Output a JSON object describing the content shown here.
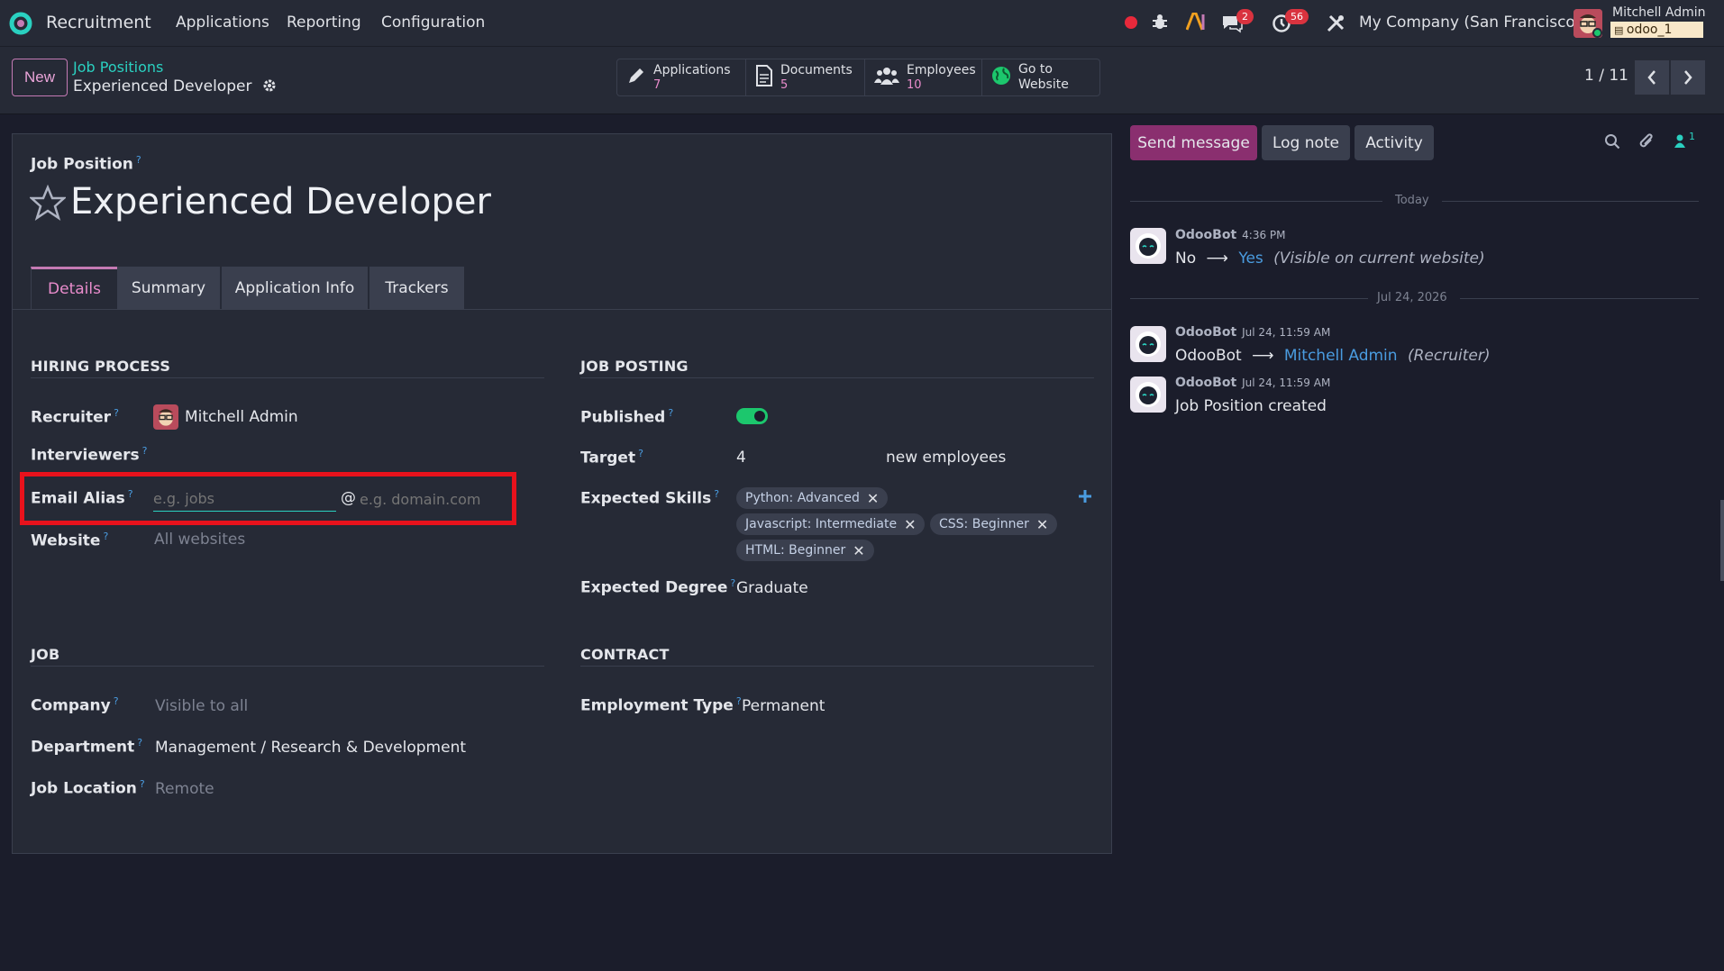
{
  "navbar": {
    "app_name": "Recruitment",
    "menus": [
      "Applications",
      "Reporting",
      "Configuration"
    ],
    "chat_badge": "2",
    "activity_badge": "56",
    "company": "My Company (San Francisco)",
    "user_name": "Mitchell Admin",
    "db_name": "odoo_1",
    "colors": {
      "accent": "#2ad0c0",
      "badge": "#d9333f",
      "record_dot": "#e8293b"
    }
  },
  "control": {
    "new_label": "New",
    "breadcrumb_parent": "Job Positions",
    "breadcrumb_current": "Experienced Developer",
    "smart_buttons": [
      {
        "label": "Applications",
        "value": "7",
        "icon": "pencil-icon"
      },
      {
        "label": "Documents",
        "value": "5",
        "icon": "document-icon"
      },
      {
        "label": "Employees",
        "value": "10",
        "icon": "users-icon"
      },
      {
        "label": "Go to",
        "label2": "Website",
        "icon": "globe-icon"
      }
    ],
    "pager": "1 / 11"
  },
  "form": {
    "job_position_label": "Job Position",
    "title": "Experienced Developer",
    "tabs": [
      "Details",
      "Summary",
      "Application Info",
      "Trackers"
    ],
    "hiring": {
      "section": "HIRING PROCESS",
      "recruiter_label": "Recruiter",
      "recruiter_value": "Mitchell Admin",
      "interviewers_label": "Interviewers",
      "email_alias_label": "Email Alias",
      "email_alias_placeholder": "e.g. jobs",
      "email_at": "@",
      "email_domain_placeholder": "e.g. domain.com",
      "website_label": "Website",
      "website_placeholder": "All websites"
    },
    "posting": {
      "section": "JOB POSTING",
      "published_label": "Published",
      "published": true,
      "target_label": "Target",
      "target_value": "4",
      "target_suffix": "new employees",
      "skills_label": "Expected Skills",
      "skills": [
        "Python: Advanced",
        "Javascript: Intermediate",
        "CSS: Beginner",
        "HTML: Beginner"
      ],
      "degree_label": "Expected Degree",
      "degree_value": "Graduate"
    },
    "job": {
      "section": "JOB",
      "company_label": "Company",
      "company_placeholder": "Visible to all",
      "department_label": "Department",
      "department_value": "Management / Research & Development",
      "location_label": "Job Location",
      "location_placeholder": "Remote"
    },
    "contract": {
      "section": "CONTRACT",
      "employment_label": "Employment Type",
      "employment_value": "Permanent"
    }
  },
  "chatter": {
    "send_message": "Send message",
    "log_note": "Log note",
    "activity": "Activity",
    "followers_count": "1",
    "today_label": "Today",
    "date_label": "Jul 24, 2026",
    "messages": [
      {
        "author": "OdooBot",
        "time": "4:36 PM",
        "old": "No",
        "new": "Yes",
        "field": "(Visible on current website)"
      },
      {
        "author": "OdooBot",
        "time": "Jul 24, 11:59 AM",
        "old": "OdooBot",
        "new": "Mitchell Admin",
        "field": "(Recruiter)"
      },
      {
        "author": "OdooBot",
        "time": "Jul 24, 11:59 AM",
        "body": "Job Position created"
      }
    ]
  }
}
